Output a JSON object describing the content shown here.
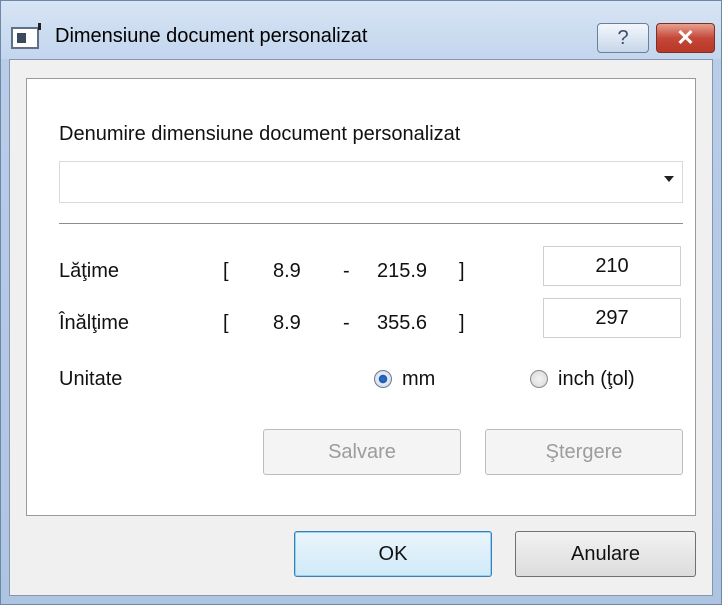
{
  "window": {
    "title": "Dimensiune document personalizat"
  },
  "titlebar": {
    "help_label": "?",
    "close_label": "✕"
  },
  "form": {
    "name_label": "Denumire dimensiune document personalizat",
    "name_value": "",
    "width": {
      "label": "Lăţime",
      "bracket_open": "[",
      "min": "8.9",
      "dash": "-",
      "max": "215.9",
      "bracket_close": "]",
      "value": "210"
    },
    "height": {
      "label": "Înălţime",
      "bracket_open": "[",
      "min": "8.9",
      "dash": "-",
      "max": "355.6",
      "bracket_close": "]",
      "value": "297"
    },
    "unit": {
      "label": "Unitate",
      "options": [
        "mm",
        "inch (ţol)"
      ],
      "selected": "mm"
    },
    "save_label": "Salvare",
    "delete_label": "Ştergere"
  },
  "footer": {
    "ok_label": "OK",
    "cancel_label": "Anulare"
  },
  "colors": {
    "title_bg": "#c3d6ee",
    "close_red": "#c4483a",
    "radio_selected": "#1d58b0"
  }
}
